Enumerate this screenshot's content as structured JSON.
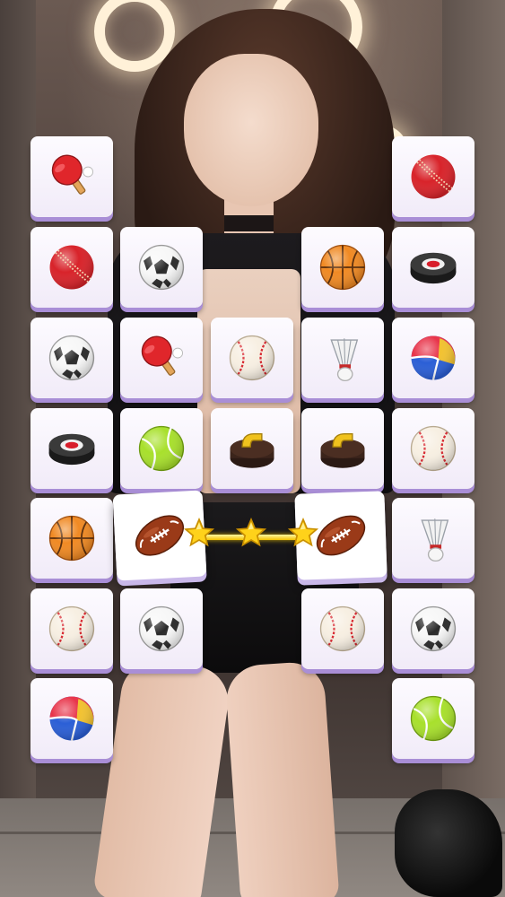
{
  "game": {
    "type": "tile-match",
    "theme": "sports-balls",
    "colors": {
      "tile_face": "#fdfbff",
      "tile_edge": "#a98ed6",
      "link_line": "#f5c400"
    }
  },
  "board": {
    "tiles": [
      {
        "row": 1,
        "col": 1,
        "item": "ping-pong-paddle",
        "selected": false
      },
      {
        "row": 1,
        "col": 5,
        "item": "cricket-ball",
        "selected": false
      },
      {
        "row": 2,
        "col": 1,
        "item": "cricket-ball",
        "selected": false
      },
      {
        "row": 2,
        "col": 2,
        "item": "soccer-ball",
        "selected": false
      },
      {
        "row": 2,
        "col": 4,
        "item": "basketball",
        "selected": false
      },
      {
        "row": 2,
        "col": 5,
        "item": "hockey-puck",
        "selected": false
      },
      {
        "row": 3,
        "col": 1,
        "item": "soccer-ball",
        "selected": false
      },
      {
        "row": 3,
        "col": 2,
        "item": "ping-pong-paddle",
        "selected": false
      },
      {
        "row": 3,
        "col": 3,
        "item": "baseball",
        "selected": false
      },
      {
        "row": 3,
        "col": 4,
        "item": "shuttlecock",
        "selected": false
      },
      {
        "row": 3,
        "col": 5,
        "item": "volleyball",
        "selected": false
      },
      {
        "row": 4,
        "col": 1,
        "item": "hockey-puck",
        "selected": false
      },
      {
        "row": 4,
        "col": 2,
        "item": "tennis-ball",
        "selected": false
      },
      {
        "row": 4,
        "col": 3,
        "item": "curling-stone",
        "selected": false
      },
      {
        "row": 4,
        "col": 4,
        "item": "curling-stone",
        "selected": false
      },
      {
        "row": 4,
        "col": 5,
        "item": "baseball",
        "selected": false
      },
      {
        "row": 5,
        "col": 1,
        "item": "basketball",
        "selected": false
      },
      {
        "row": 5,
        "col": 2,
        "item": "american-football",
        "selected": true
      },
      {
        "row": 5,
        "col": 4,
        "item": "american-football",
        "selected": true
      },
      {
        "row": 5,
        "col": 5,
        "item": "shuttlecock",
        "selected": false
      },
      {
        "row": 6,
        "col": 1,
        "item": "baseball",
        "selected": false
      },
      {
        "row": 6,
        "col": 2,
        "item": "soccer-ball",
        "selected": false
      },
      {
        "row": 6,
        "col": 4,
        "item": "baseball",
        "selected": false
      },
      {
        "row": 6,
        "col": 5,
        "item": "soccer-ball",
        "selected": false
      },
      {
        "row": 7,
        "col": 1,
        "item": "volleyball",
        "selected": false
      },
      {
        "row": 7,
        "col": 5,
        "item": "tennis-ball",
        "selected": false
      }
    ],
    "match_link": {
      "from": [
        5,
        2
      ],
      "to": [
        5,
        4
      ],
      "stars": 3
    }
  }
}
